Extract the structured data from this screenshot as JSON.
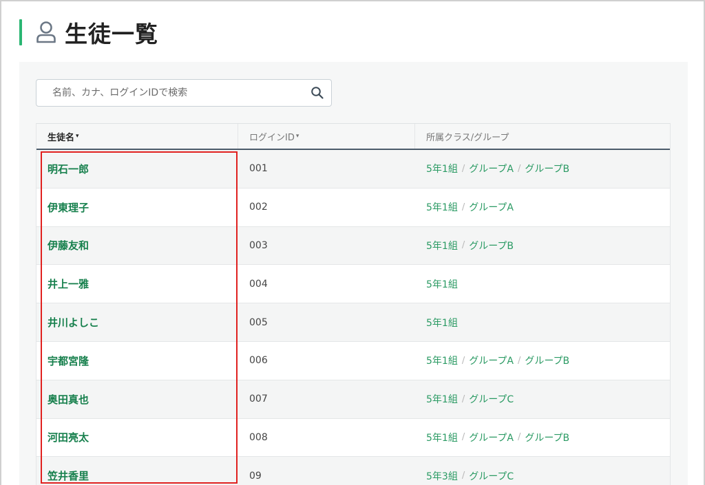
{
  "page": {
    "title": "生徒一覧",
    "accent_color": "#2bb673",
    "icon": "person-icon"
  },
  "search": {
    "placeholder": "名前、カナ、ログインIDで検索",
    "value": "",
    "icon": "search-icon"
  },
  "table": {
    "columns": [
      {
        "label": "生徒名",
        "sort_caret": "▾",
        "active": true
      },
      {
        "label": "ログインID",
        "sort_caret": "▾",
        "active": false
      },
      {
        "label": "所属クラス/グループ",
        "sort_caret": "",
        "active": false
      }
    ],
    "rows": [
      {
        "name": "明石一郎",
        "login_id": "001",
        "groups": [
          "5年1組",
          "グループA",
          "グループB"
        ]
      },
      {
        "name": "伊東理子",
        "login_id": "002",
        "groups": [
          "5年1組",
          "グループA"
        ]
      },
      {
        "name": "伊藤友和",
        "login_id": "003",
        "groups": [
          "5年1組",
          "グループB"
        ]
      },
      {
        "name": "井上一雅",
        "login_id": "004",
        "groups": [
          "5年1組"
        ]
      },
      {
        "name": "井川よしこ",
        "login_id": "005",
        "groups": [
          "5年1組"
        ]
      },
      {
        "name": "宇都宮隆",
        "login_id": "006",
        "groups": [
          "5年1組",
          "グループA",
          "グループB"
        ]
      },
      {
        "name": "奥田真也",
        "login_id": "007",
        "groups": [
          "5年1組",
          "グループC"
        ]
      },
      {
        "name": "河田亮太",
        "login_id": "008",
        "groups": [
          "5年1組",
          "グループA",
          "グループB"
        ]
      },
      {
        "name": "笠井香里",
        "login_id": "09",
        "groups": [
          "5年3組",
          "グループC"
        ]
      }
    ]
  },
  "colors": {
    "link_green": "#17804d",
    "group_green": "#2a9a63",
    "highlight_red": "#e0201e"
  }
}
